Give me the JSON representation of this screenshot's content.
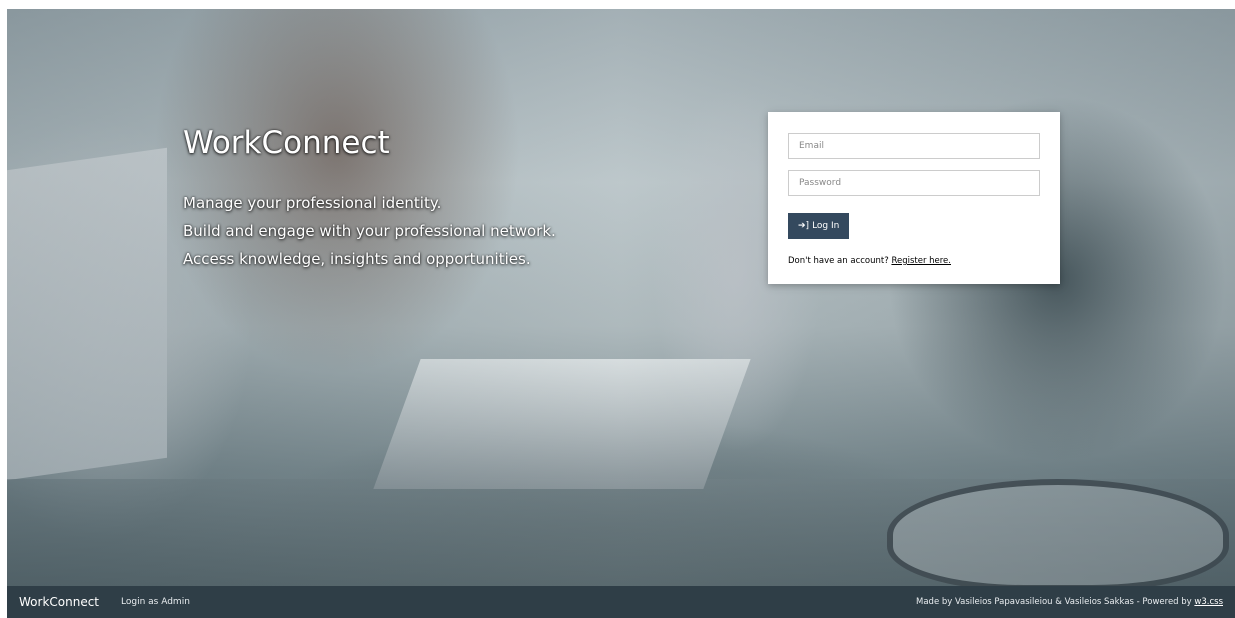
{
  "hero": {
    "title": "WorkConnect",
    "taglines": [
      "Manage your professional identity.",
      "Build and engage with your professional network.",
      "Access knowledge, insights and opportunities."
    ]
  },
  "login": {
    "email_placeholder": "Email",
    "password_placeholder": "Password",
    "button_icon": "sign-in-icon",
    "button_label": "Log In",
    "register_prompt": "Don't have an account?",
    "register_link": "Register here."
  },
  "footer": {
    "brand": "WorkConnect",
    "admin_link": "Login as Admin",
    "credits_text": "Made by Vasileios Papavasileiou & Vasileios Sakkas - Powered by",
    "credits_link": "w3.css"
  },
  "colors": {
    "button": "#34495e",
    "footer": "#2f3e47",
    "card": "#ffffff"
  }
}
